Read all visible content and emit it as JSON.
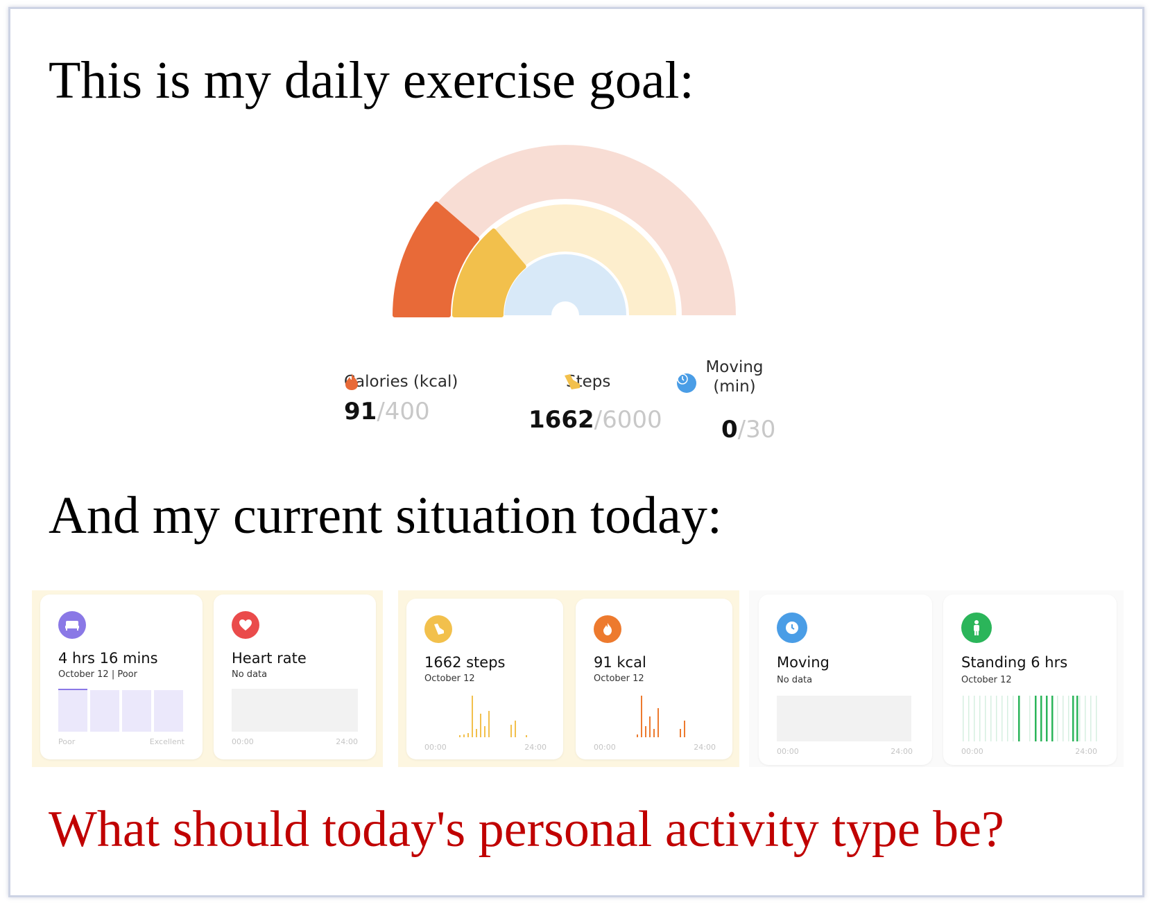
{
  "heading_goal": "This is my daily exercise goal:",
  "heading_current": "And my current situation today:",
  "question": "What should today's personal activity type be?",
  "colors": {
    "calories": "#e86a38",
    "steps": "#f2c04c",
    "moving": "#4a9de6",
    "calories_track": "#f8ddd4",
    "steps_track": "#fdeecd",
    "moving_track": "#d8e9f8",
    "question": "#c00000",
    "sleep": "#8a78e6",
    "heart": "#ea4b4b",
    "standing": "#2bb55a"
  },
  "goal": {
    "calories": {
      "icon": "flame-icon",
      "label": "Calories (kcal)",
      "current": "91",
      "goal": "/400",
      "progress": 0.2275
    },
    "steps": {
      "icon": "shoe-icon",
      "label": "Steps",
      "current": "1662",
      "goal": "/6000",
      "progress": 0.277
    },
    "moving": {
      "icon": "clock-icon",
      "label": "Moving (min)",
      "current": "0",
      "goal": "/30",
      "progress": 0
    }
  },
  "cards": {
    "sleep": {
      "icon": "bed-icon",
      "title": "4 hrs 16 mins",
      "sub": "October 12 | Poor",
      "axis_left": "Poor",
      "axis_right": "Excellent"
    },
    "heart": {
      "icon": "heart-icon",
      "title": "Heart rate",
      "sub": "No data",
      "axis_left": "00:00",
      "axis_right": "24:00"
    },
    "steps": {
      "icon": "shoe-icon",
      "title": "1662 steps",
      "sub": "October 12",
      "axis_left": "00:00",
      "axis_right": "24:00"
    },
    "kcal": {
      "icon": "flame-icon",
      "title": "91 kcal",
      "sub": "October 12",
      "axis_left": "00:00",
      "axis_right": "24:00"
    },
    "moving": {
      "icon": "clock-icon",
      "title": "Moving",
      "sub": "No data",
      "axis_left": "00:00",
      "axis_right": "24:00"
    },
    "standing": {
      "icon": "person-icon",
      "title": "Standing 6 hrs",
      "sub": "October 12",
      "axis_left": "00:00",
      "axis_right": "24:00"
    }
  }
}
